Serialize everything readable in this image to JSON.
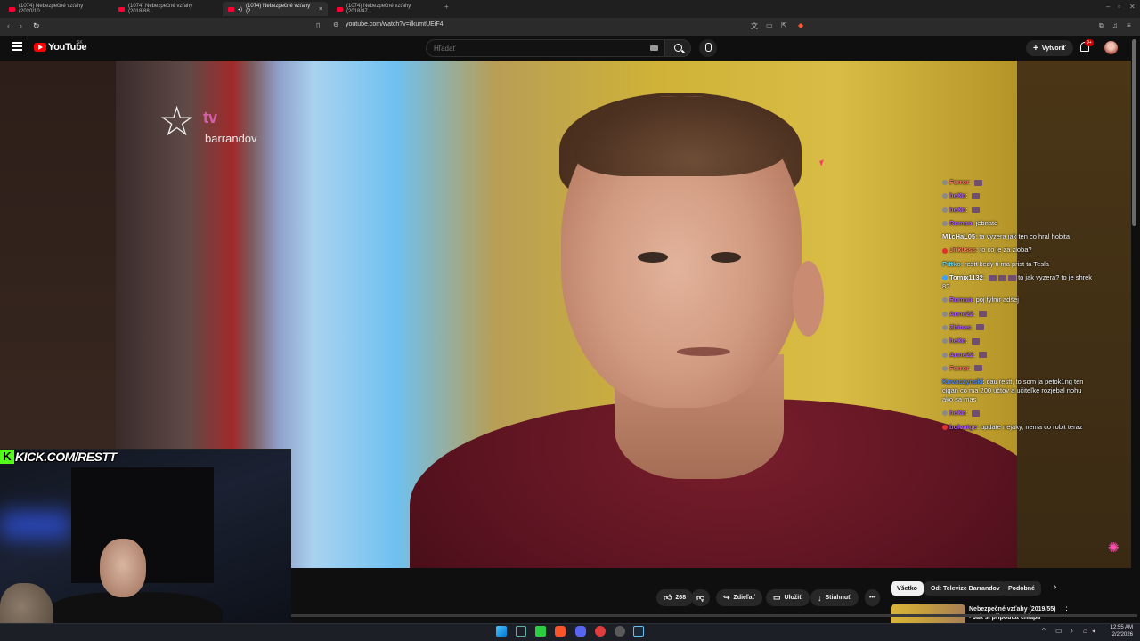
{
  "browser": {
    "tabs": [
      {
        "label": "(1074) Nebezpečné vzťahy (2020/10..."
      },
      {
        "label": "(1074) Nebezpečné vzťahy (2018/88..."
      },
      {
        "label": "(1074) Nebezpečné vzťahy (2..."
      },
      {
        "label": "(1074) Nebezpečné vzťahy (2018/47..."
      }
    ],
    "new_tab": "+",
    "close_tab": "×",
    "url": "youtube.com/watch?v=ilkumtUEiF4"
  },
  "youtube": {
    "logo_text": "YouTube",
    "country": "SK",
    "search_placeholder": "Hľadať",
    "create_label": "Vytvoriť",
    "notif_count": "9+"
  },
  "video": {
    "channel_logo_tv": "tv",
    "channel_logo_name": "barrandov",
    "kick_text": "KICK.COM/RESTT"
  },
  "chat": [
    {
      "user": "Ferror",
      "msg": "",
      "emote": true,
      "color": "#ff6b6b"
    },
    {
      "user": "heXn",
      "msg": "",
      "emote": true,
      "color": "#b25cff"
    },
    {
      "user": "heXn",
      "msg": "",
      "emote": true,
      "color": "#b25cff"
    },
    {
      "user": "Roman",
      "msg": "jebnato",
      "emote": false,
      "color": "#b25cff"
    },
    {
      "user": "M1cHaL05",
      "msg": "ta vyzera jak ten co hral hobita",
      "emote": false,
      "color": "#ffffff"
    },
    {
      "user": "Jirk0sss",
      "msg": "to co je za zloba?",
      "emote": false,
      "color": "#ff8a5c"
    },
    {
      "user": "Pittko",
      "msg": "restt kedy ti ma prist ta Tesla",
      "emote": false,
      "color": "#66e0ff"
    },
    {
      "user": "Tomix1132",
      "msg": "to jak vyzera? to je shrek 8?",
      "emote": true,
      "color": "#ffffff"
    },
    {
      "user": "Roman",
      "msg": "poj fylmr adšej",
      "emote": false,
      "color": "#b25cff"
    },
    {
      "user": "Anne22",
      "msg": "",
      "emote": true,
      "color": "#b25cff"
    },
    {
      "user": "Zbinas",
      "msg": "",
      "emote": true,
      "color": "#b25cff"
    },
    {
      "user": "heXn",
      "msg": "",
      "emote": true,
      "color": "#b25cff"
    },
    {
      "user": "Anne22",
      "msg": "",
      "emote": true,
      "color": "#b25cff"
    },
    {
      "user": "Ferror",
      "msg": "",
      "emote": true,
      "color": "#ff6b6b"
    },
    {
      "user": "Kovaczynski",
      "msg": "cau restt, to som ja petok1ng ten cigan co ma 200 účtov a učiteľke rozjebal nohu ako sa mas",
      "emote": false,
      "color": "#4f8cff"
    },
    {
      "user": "heXn",
      "msg": "",
      "emote": true,
      "color": "#b25cff"
    },
    {
      "user": "bolvatge",
      "msg": "update nejaky, nema co robit teraz",
      "emote": false,
      "color": "#b25cff"
    }
  ],
  "actions": {
    "likes": "268",
    "share": "Zdieľať",
    "save": "Uložiť",
    "download": "Stiahnuť",
    "more": "•••"
  },
  "chips": [
    {
      "label": "Všetko"
    },
    {
      "label": "Od: Televize Barrandov"
    },
    {
      "label": "Podobné"
    }
  ],
  "related": {
    "title": "Nebezpečné vzťahy (2019/55) - Jak si připoutat chlapa"
  },
  "taskbar": {
    "time": "12:55 AM",
    "date": "2/2/2026"
  }
}
